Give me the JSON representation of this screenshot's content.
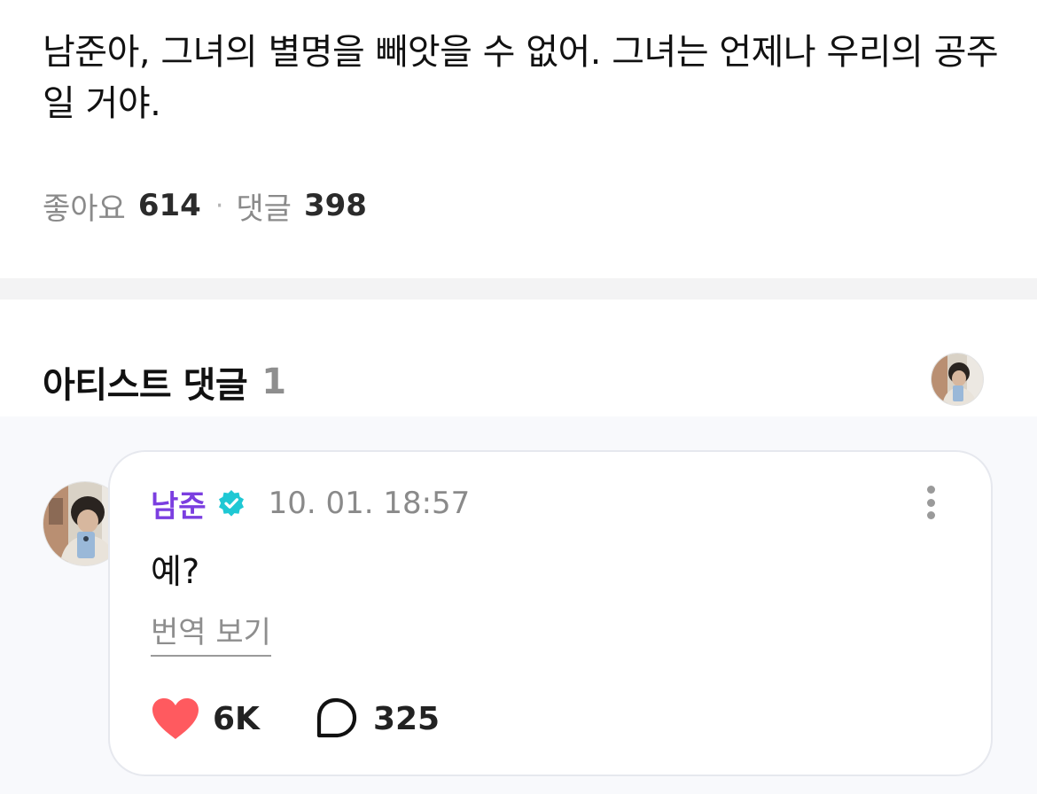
{
  "post": {
    "body": "남준아, 그녀의 별명을 빼앗을 수 없어. 그녀는 언제나 우리의 공주일 거야.",
    "likes_label": "좋아요",
    "likes_count": "614",
    "dot": "·",
    "comments_label": "댓글",
    "comments_count": "398"
  },
  "artist_comments": {
    "title": "아티스트 댓글",
    "count": "1",
    "comments": [
      {
        "author": "남준",
        "timestamp": "10. 01. 18:57",
        "text": "예?",
        "translate_label": "번역 보기",
        "likes": "6K",
        "replies": "325"
      }
    ]
  },
  "icons": {
    "verified": "verified-badge-icon",
    "more": "more-vertical-icon",
    "like": "heart-icon",
    "reply": "speech-bubble-icon"
  },
  "colors": {
    "author": "#7b3ee0",
    "verified": "#1fc8d4",
    "heart": "#ff5a5f",
    "muted": "#8a8a8a",
    "comment_area_bg": "#f8f9fc",
    "divider": "#f3f3f4"
  }
}
